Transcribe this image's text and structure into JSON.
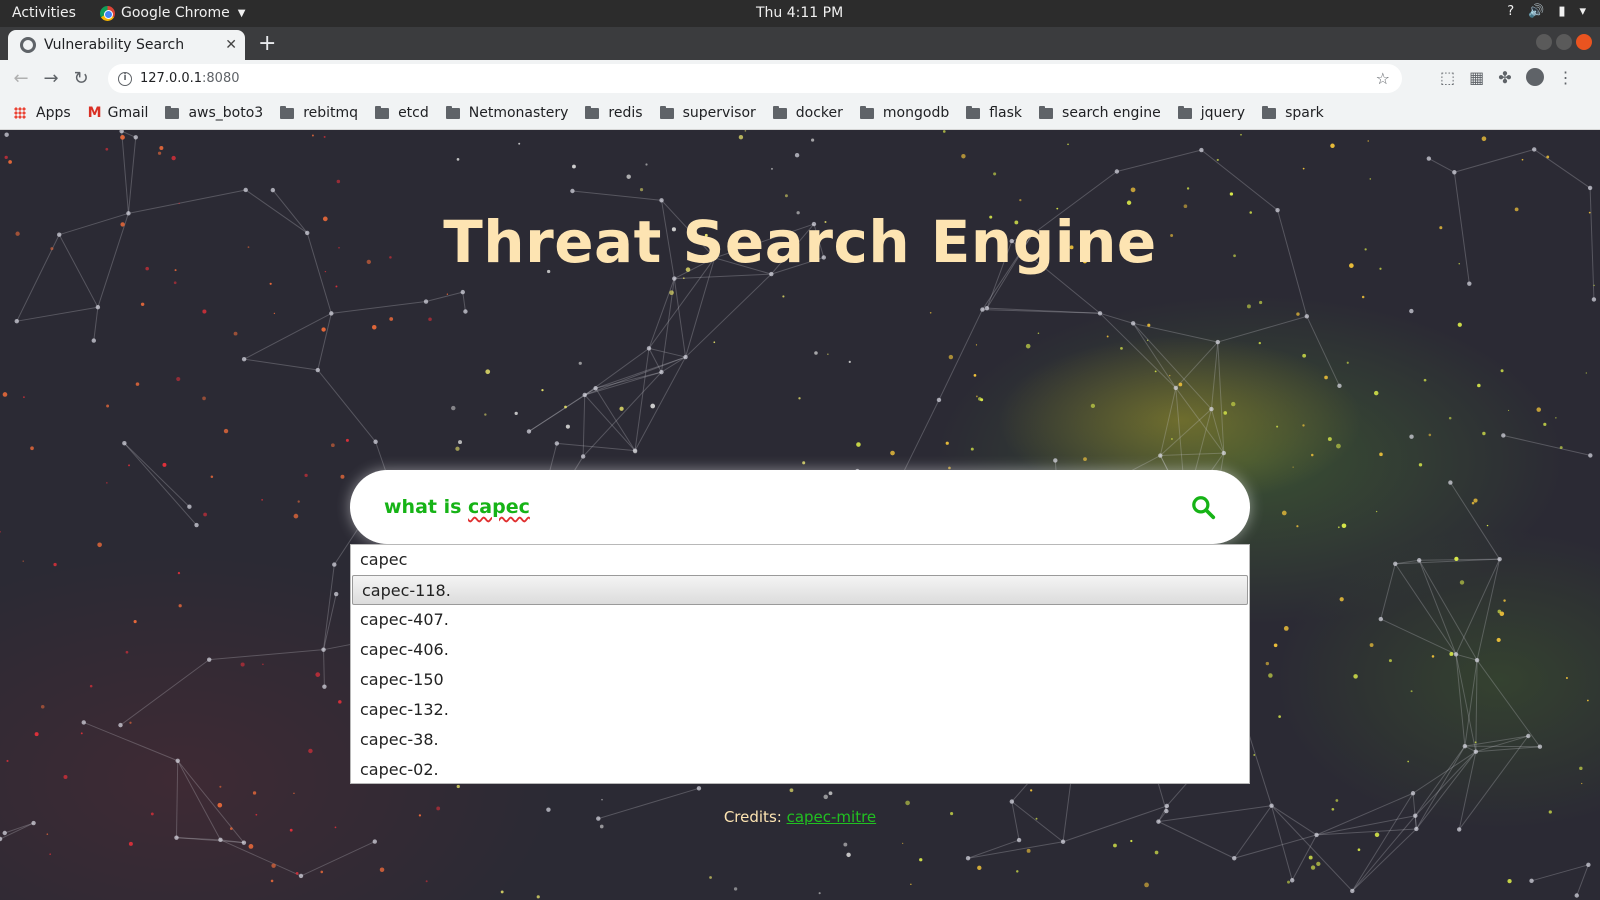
{
  "os_bar": {
    "activities": "Activities",
    "app_name": "Google Chrome",
    "clock": "Thu  4:11 PM",
    "tray_question": "?"
  },
  "browser": {
    "tab_title": "Vulnerability Search",
    "url_host": "127.0.0.1",
    "url_port": ":8080",
    "bookmarks": [
      "aws_boto3",
      "rebitmq",
      "etcd",
      "Netmonastery",
      "redis",
      "supervisor",
      "docker",
      "mongodb",
      "flask",
      "search engine",
      "jquery",
      "spark"
    ],
    "bookmark_apps": "Apps",
    "bookmark_gmail": "Gmail"
  },
  "page": {
    "title": "Threat Search Engine",
    "search_prefix": "what is ",
    "search_term": "capec",
    "suggestions": [
      "capec",
      "capec-118.",
      "capec-407.",
      "capec-406.",
      "capec-150",
      "capec-132.",
      "capec-38.",
      "capec-02."
    ],
    "active_suggestion_index": 1,
    "credits_label": "Credits: ",
    "credits_link": "capec-mitre"
  },
  "colors": {
    "title": "#fde4b2",
    "query_text": "#16b316",
    "link": "#21c021"
  },
  "icons": {
    "search": "search-icon",
    "reload": "reload-icon",
    "star": "star-icon"
  }
}
